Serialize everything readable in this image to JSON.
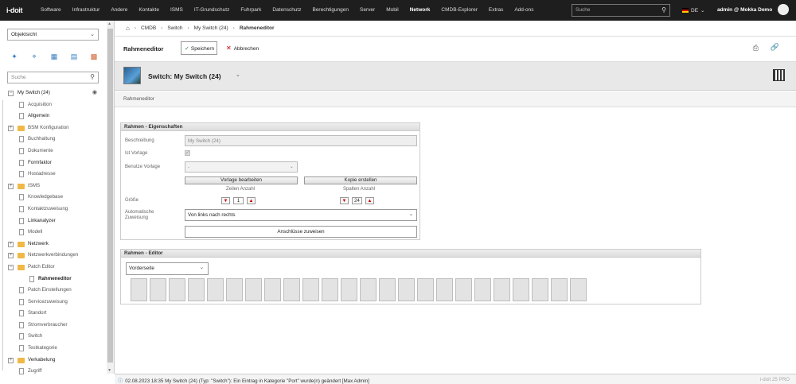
{
  "brand": {
    "logo_text": "i-doit"
  },
  "nav": {
    "items": [
      "Software",
      "Infrastruktur",
      "Andere",
      "Kontakte",
      "ISMS",
      "IT-Grundschutz",
      "Fuhrpark",
      "Datenschutz",
      "Berechtigungen",
      "Server",
      "Mobil",
      "Network",
      "CMDB-Explorer",
      "Extras",
      "Add-ons"
    ],
    "active": "Network",
    "search_placeholder": "Suche",
    "language": "DE",
    "user": "admin @ Mokka Demo"
  },
  "sidebar": {
    "view_select": "Objektsicht",
    "search_placeholder": "Suche",
    "root": "My Switch (24)",
    "items": [
      {
        "label": "Acquisition",
        "type": "doc"
      },
      {
        "label": "Allgemein",
        "type": "doc",
        "bold": true
      },
      {
        "label": "BSM Konfiguration",
        "type": "folder"
      },
      {
        "label": "Buchhaltung",
        "type": "doc"
      },
      {
        "label": "Dokumente",
        "type": "doc"
      },
      {
        "label": "Formfaktor",
        "type": "doc",
        "bold": true
      },
      {
        "label": "Hostadresse",
        "type": "doc"
      },
      {
        "label": "ISMS",
        "type": "folder"
      },
      {
        "label": "Knowledgebase",
        "type": "doc"
      },
      {
        "label": "Kontaktzuweisung",
        "type": "doc"
      },
      {
        "label": "Linkanalyzer",
        "type": "doc",
        "bold": true
      },
      {
        "label": "Modell",
        "type": "doc"
      },
      {
        "label": "Netzwerk",
        "type": "folder",
        "bold": true
      },
      {
        "label": "Netzwerkverbindungen",
        "type": "folder"
      },
      {
        "label": "Patch Editor",
        "type": "folder",
        "open": true
      },
      {
        "label": "Rahmeneditor",
        "type": "child"
      },
      {
        "label": "Patch Einstellungen",
        "type": "doc"
      },
      {
        "label": "Servicezuweisung",
        "type": "doc"
      },
      {
        "label": "Standort",
        "type": "doc"
      },
      {
        "label": "Stromverbraucher",
        "type": "doc"
      },
      {
        "label": "Switch",
        "type": "doc"
      },
      {
        "label": "Testkategorie",
        "type": "doc"
      },
      {
        "label": "Verkabelung",
        "type": "folder",
        "bold": true
      },
      {
        "label": "Zugriff",
        "type": "doc"
      }
    ]
  },
  "breadcrumb": [
    "CMDB",
    "Switch",
    "My Switch (24)",
    "Rahmeneditor"
  ],
  "toolbar": {
    "title": "Rahmeneditor",
    "save_label": "Speichern",
    "cancel_label": "Abbrechen"
  },
  "object": {
    "title": "Switch: My Switch (24)"
  },
  "section_tab": "Rahmeneditor",
  "props": {
    "header": "Rahmen - Eigenschaften",
    "desc_label": "Beschreibung",
    "desc_value": "My Switch (24)",
    "template_label": "Ist Vorlage",
    "use_template_label": "Benutze Vorlage",
    "use_template_value": "-",
    "edit_template_btn": "Vorlage bearbeiten",
    "copy_btn": "Kopie erstellen",
    "size_label": "Größe",
    "rows_label": "Zeilen Anzahl",
    "rows_value": "1",
    "cols_label": "Spalten Anzahl",
    "cols_value": "24",
    "auto_label_1": "Automatische",
    "auto_label_2": "Zuweisung",
    "auto_value": "Von links nach rechts",
    "assign_btn": "Anschlüsse zuweisen"
  },
  "editor": {
    "header": "Rahmen - Editor",
    "side_value": "Vorderseite",
    "slot_count": 24
  },
  "statusbar": {
    "message": "02.08.2023 18:35 My Switch (24) (Typ: \"Switch\"): Ein Eintrag in Kategorie \"Port\" wurde(n) geändert [Max Admin]",
    "version": "i-doit 25 PRO"
  }
}
